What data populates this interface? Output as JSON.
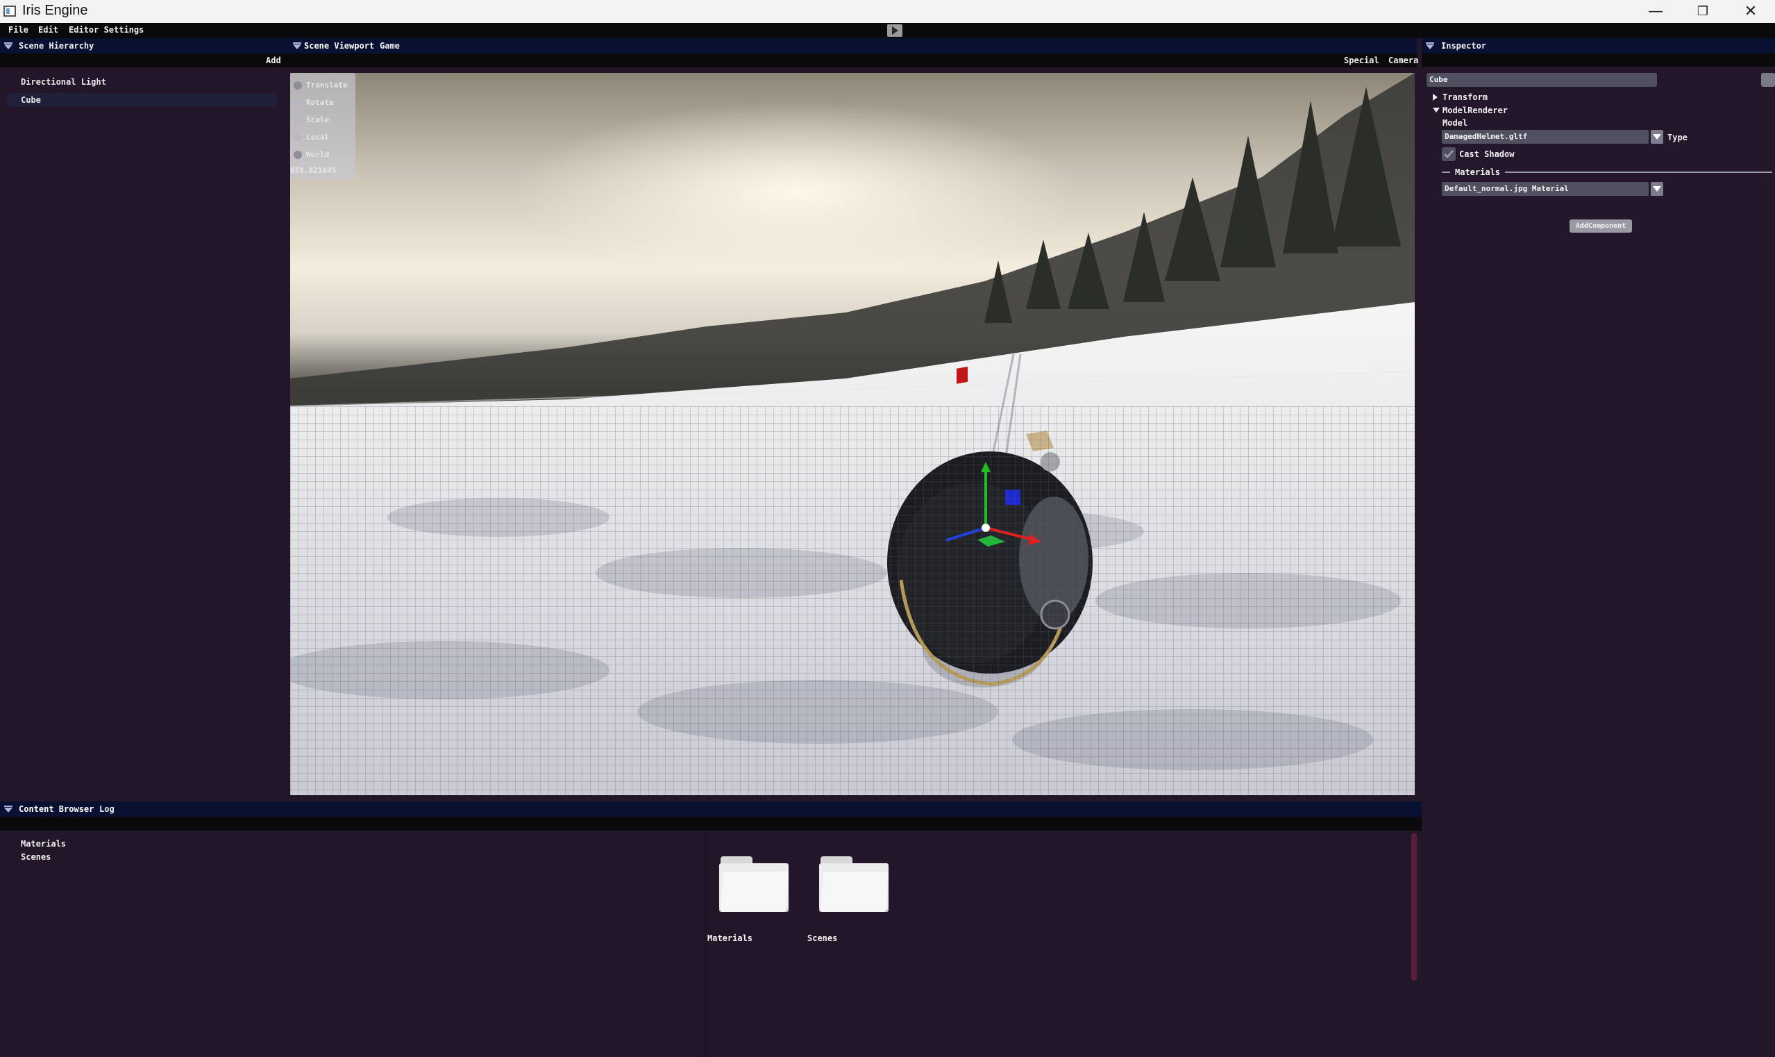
{
  "window": {
    "title": "Iris Engine",
    "controls": [
      "minimize",
      "restore",
      "close"
    ]
  },
  "menubar": {
    "items": [
      "File",
      "Edit",
      "Editor Settings"
    ]
  },
  "hierarchy": {
    "title": "Scene Hierarchy",
    "add_label": "Add",
    "items": [
      {
        "label": "Directional Light",
        "selected": false
      },
      {
        "label": "Cube",
        "selected": true
      }
    ]
  },
  "viewport": {
    "tabs": [
      "Scene Viewport",
      "Game"
    ],
    "toolbar": {
      "special": "Special",
      "camera": "Camera"
    },
    "gizmo_options": [
      "Translate",
      "Rotate",
      "Scale",
      "Local",
      "World"
    ],
    "fps": "658.821045"
  },
  "inspector": {
    "title": "Inspector",
    "name_field": "Cube",
    "components": {
      "transform": "Transform",
      "model_renderer": "ModelRenderer"
    },
    "model_label": "Model",
    "model_value": "DamagedHelmet.gltf",
    "type_label": "Type",
    "cast_shadow": {
      "label": "Cast Shadow",
      "checked": true
    },
    "materials_label": "Materials",
    "material_value": "Default_normal.jpg Material",
    "add_component": "AddComponent"
  },
  "bottom_panel": {
    "tabs": [
      "Content Browser",
      "Log"
    ],
    "tree": [
      "Materials",
      "Scenes"
    ],
    "folders": [
      {
        "label": "Materials",
        "icon": "folder-icon"
      },
      {
        "label": "Scenes",
        "icon": "folder-icon"
      }
    ]
  },
  "colors": {
    "panel_bg": "#231629",
    "header_bg": "#091133",
    "menubar_bg": "#0a090c",
    "selection": "#20203a",
    "gizmo_x": "#e02020",
    "gizmo_y": "#20c020",
    "gizmo_z": "#2040e0"
  }
}
